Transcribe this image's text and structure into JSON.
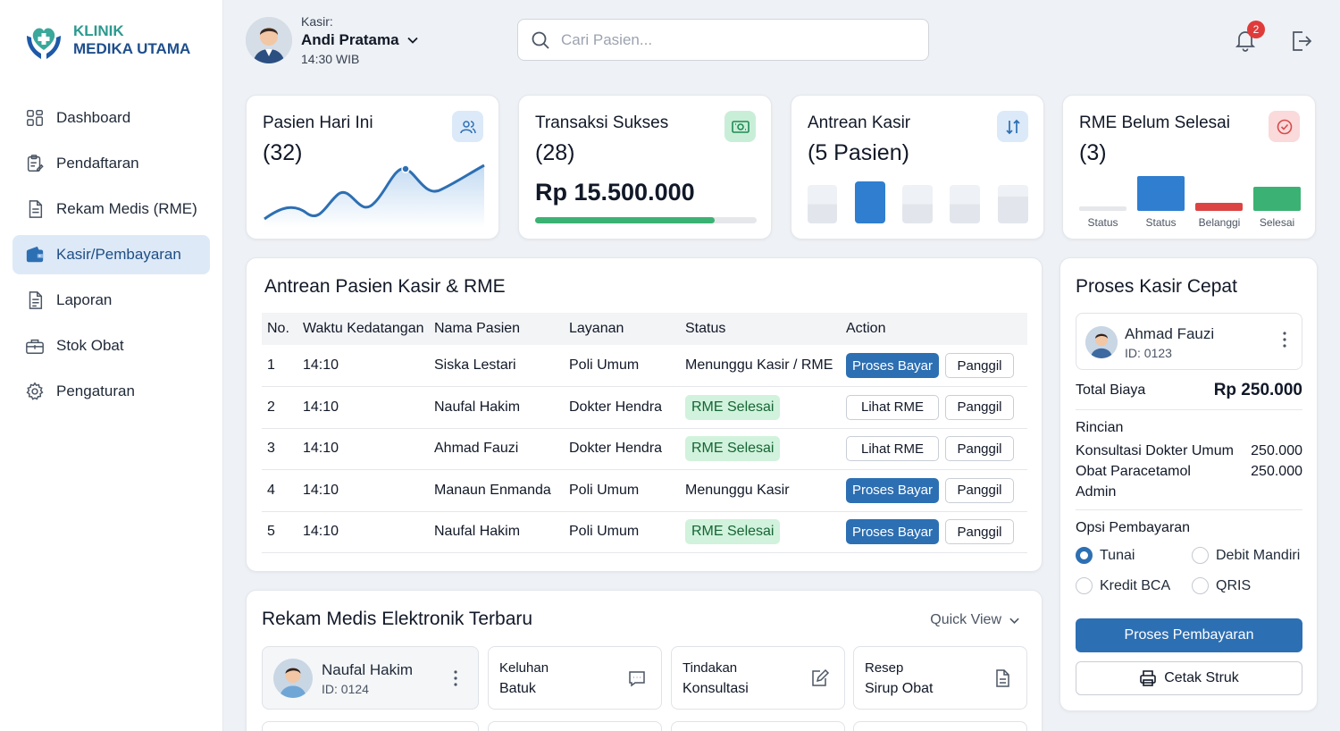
{
  "brand": {
    "line1": "KLINIK",
    "line2": "MEDIKA UTAMA"
  },
  "sidebar": {
    "items": [
      {
        "label": "Dashboard",
        "icon": "dashboard-icon"
      },
      {
        "label": "Pendaftaran",
        "icon": "clipboard-icon"
      },
      {
        "label": "Rekam Medis (RME)",
        "icon": "document-icon"
      },
      {
        "label": "Kasir/Pembayaran",
        "icon": "wallet-icon",
        "active": true
      },
      {
        "label": "Laporan",
        "icon": "report-icon"
      },
      {
        "label": "Stok Obat",
        "icon": "medicine-box-icon"
      },
      {
        "label": "Pengaturan",
        "icon": "gear-icon"
      }
    ]
  },
  "header": {
    "role_label": "Kasir:",
    "user_name": "Andi Pratama",
    "time": "14:30 WIB",
    "search_placeholder": "Cari Pasien...",
    "notification_count": "2"
  },
  "stats": [
    {
      "title": "Pasien Hari Ini",
      "value": "(32)"
    },
    {
      "title": "Transaksi Sukses",
      "value": "(28)",
      "amount": "Rp 15.500.000",
      "progress": 0.81
    },
    {
      "title": "Antrean Kasir",
      "value": "(5 Pasien)"
    },
    {
      "title": "RME Belum Selesai",
      "value": "(3)",
      "bar_labels": [
        "Status",
        "Status",
        "Belanggi",
        "Selesai"
      ]
    }
  ],
  "queue": {
    "title": "Antrean Pasien Kasir & RME",
    "columns": [
      "No.",
      "Waktu Kedatangan",
      "Nama Pasien",
      "Layanan",
      "Status",
      "Action"
    ],
    "rows": [
      {
        "no": "1",
        "time": "14:10",
        "name": "Siska Lestari",
        "service": "Poli Umum",
        "status": "Menunggu Kasir / RME",
        "status_pill": false,
        "action": "Proses Bayar",
        "action_primary": true,
        "call": "Panggil"
      },
      {
        "no": "2",
        "time": "14:10",
        "name": "Naufal Hakim",
        "service": "Dokter Hendra",
        "status": "RME Selesai",
        "status_pill": true,
        "action": "Lihat RME",
        "action_primary": false,
        "call": "Panggil"
      },
      {
        "no": "3",
        "time": "14:10",
        "name": "Ahmad Fauzi",
        "service": "Dokter Hendra",
        "status": "RME Selesai",
        "status_pill": true,
        "action": "Lihat RME",
        "action_primary": false,
        "call": "Panggil"
      },
      {
        "no": "4",
        "time": "14:10",
        "name": "Manaun Enmanda",
        "service": "Poli Umum",
        "status": "Menunggu Kasir",
        "status_pill": false,
        "action": "Proses Bayar",
        "action_primary": true,
        "call": "Panggil"
      },
      {
        "no": "5",
        "time": "14:10",
        "name": "Naufal Hakim",
        "service": "Poli Umum",
        "status": "RME Selesai",
        "status_pill": true,
        "action": "Proses Bayar",
        "action_primary": true,
        "call": "Panggil"
      }
    ]
  },
  "rme": {
    "title": "Rekam Medis Elektronik Terbaru",
    "quick_view": "Quick View",
    "patient": {
      "name": "Naufal Hakim",
      "id": "ID: 0124"
    },
    "cards": [
      {
        "label": "Keluhan",
        "value": "Batuk"
      },
      {
        "label": "Tindakan",
        "value": "Konsultasi"
      },
      {
        "label": "Resep",
        "value": "Sirup Obat"
      }
    ]
  },
  "checkout": {
    "title": "Proses Kasir Cepat",
    "patient": {
      "name": "Ahmad Fauzi",
      "id": "ID: 0123"
    },
    "total_label": "Total Biaya",
    "total_value": "Rp 250.000",
    "detail_label": "Rincian",
    "items": [
      {
        "name": "Konsultasi Dokter Umum",
        "amount": "250.000"
      },
      {
        "name": "Obat Paracetamol",
        "amount": "250.000"
      },
      {
        "name": "Admin",
        "amount": ""
      }
    ],
    "payment_label": "Opsi Pembayaran",
    "options": [
      "Tunai",
      "Debit Mandiri",
      "Kredit BCA",
      "QRIS"
    ],
    "selected": "Tunai",
    "pay_button": "Proses Pembayaran",
    "print_button": "Cetak Struk"
  },
  "colors": {
    "primary": "#2d6fb3",
    "success": "#3bb273",
    "danger": "#e03b3b",
    "teal": "#2b9a8f"
  }
}
